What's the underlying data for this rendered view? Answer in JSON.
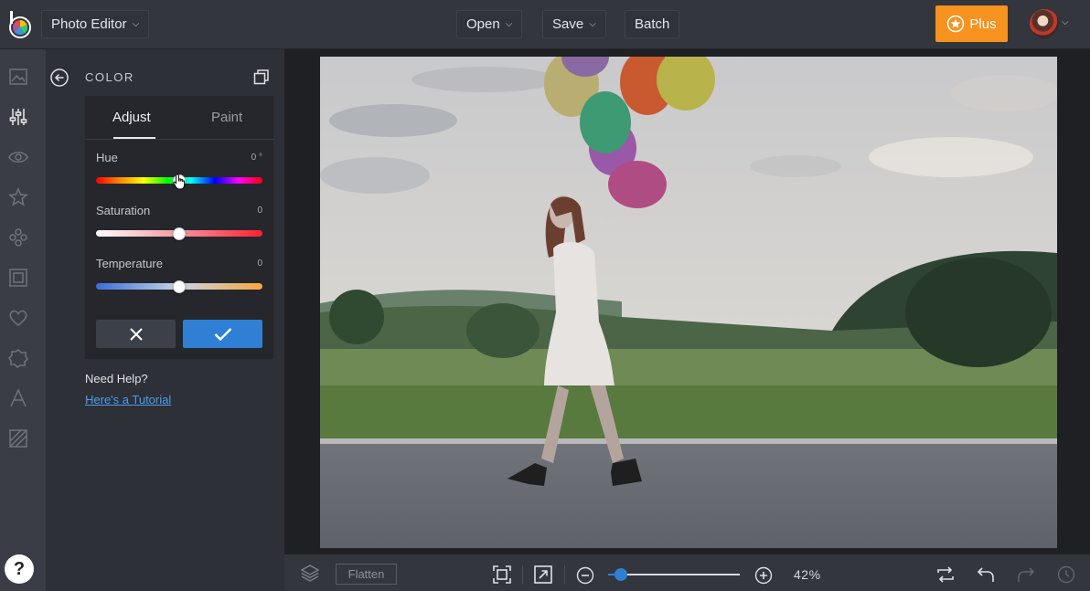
{
  "app": {
    "mode_label": "Photo Editor"
  },
  "header": {
    "open_label": "Open",
    "save_label": "Save",
    "batch_label": "Batch",
    "plus_label": "Plus"
  },
  "panel": {
    "title": "COLOR",
    "tabs": [
      {
        "label": "Adjust",
        "active": true
      },
      {
        "label": "Paint",
        "active": false
      }
    ],
    "sliders": [
      {
        "label": "Hue",
        "value": "0 °",
        "level": 0.5
      },
      {
        "label": "Saturation",
        "value": "0",
        "level": 0.5
      },
      {
        "label": "Temperature",
        "value": "0",
        "level": 0.5
      }
    ],
    "help_text": "Need Help?",
    "tutorial_link": "Here's a Tutorial"
  },
  "bottom": {
    "flatten_label": "Flatten",
    "zoom_value": "42%",
    "zoom_level": 0.1
  },
  "colors": {
    "accent": "#2f7fd4",
    "plus": "#f7931e"
  }
}
